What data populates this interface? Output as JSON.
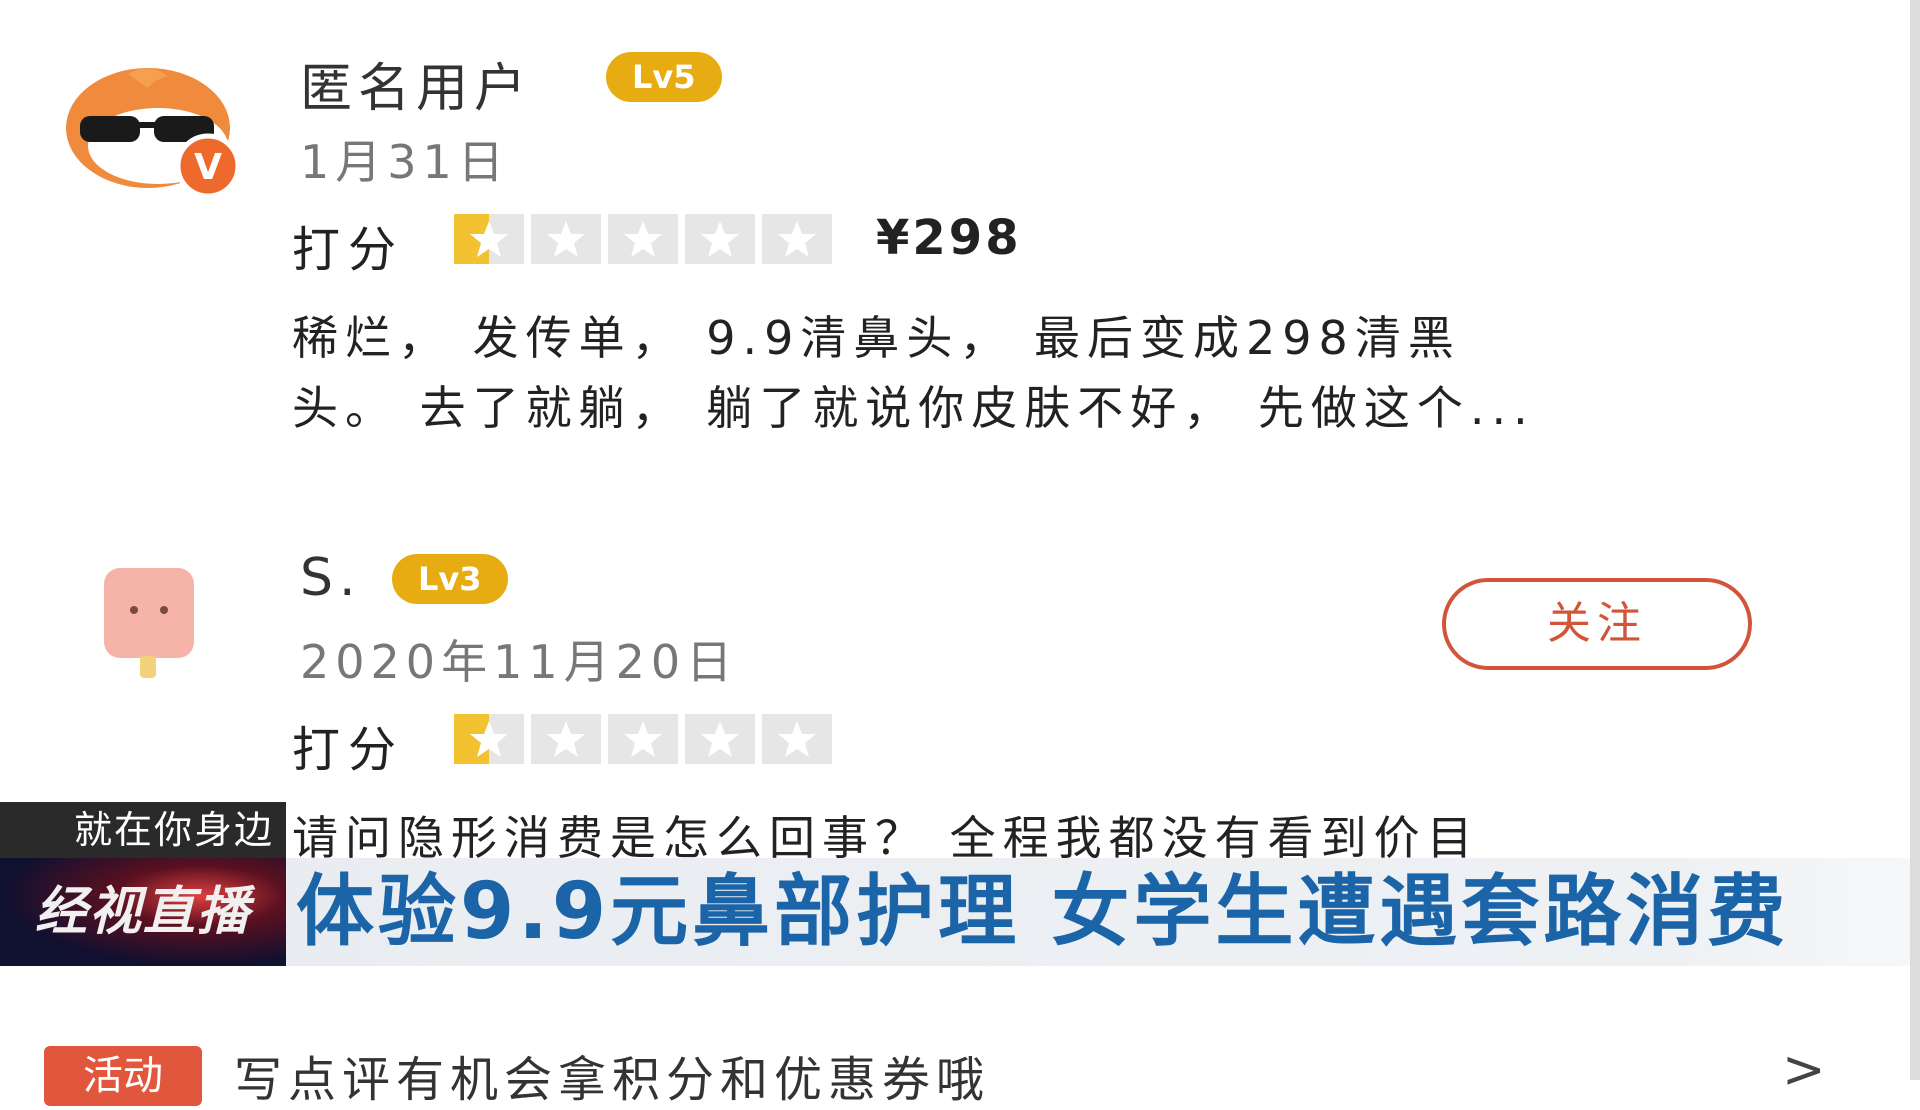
{
  "reviews": [
    {
      "user": "匿名用户",
      "level": "Lv5",
      "date": "1月31日",
      "score_label": "打分",
      "rating": 0.5,
      "price": "¥298",
      "text_line1": "稀烂， 发传单， 9.9清鼻头， 最后变成298清黑",
      "text_line2": "头。 去了就躺， 躺了就说你皮肤不好， 先做这个..."
    },
    {
      "user": "S.",
      "level": "Lv3",
      "date": "2020年11月20日",
      "score_label": "打分",
      "rating": 0.5,
      "follow_label": "关注",
      "text_line1": "请问隐形消费是怎么回事？ 全程我都没有看到价目"
    }
  ],
  "overlay": {
    "tag": "就在你身边",
    "logo": "经视直播",
    "headline": "体验9.9元鼻部护理  女学生遭遇套路消费"
  },
  "footer": {
    "badge": "活动",
    "text": "写点评有机会拿积分和优惠券哦",
    "arrow": ">"
  },
  "colors": {
    "level_badge": "#e8ac13",
    "star_fill": "#f2c230",
    "follow": "#d2553a",
    "headline": "#1c64a8"
  }
}
